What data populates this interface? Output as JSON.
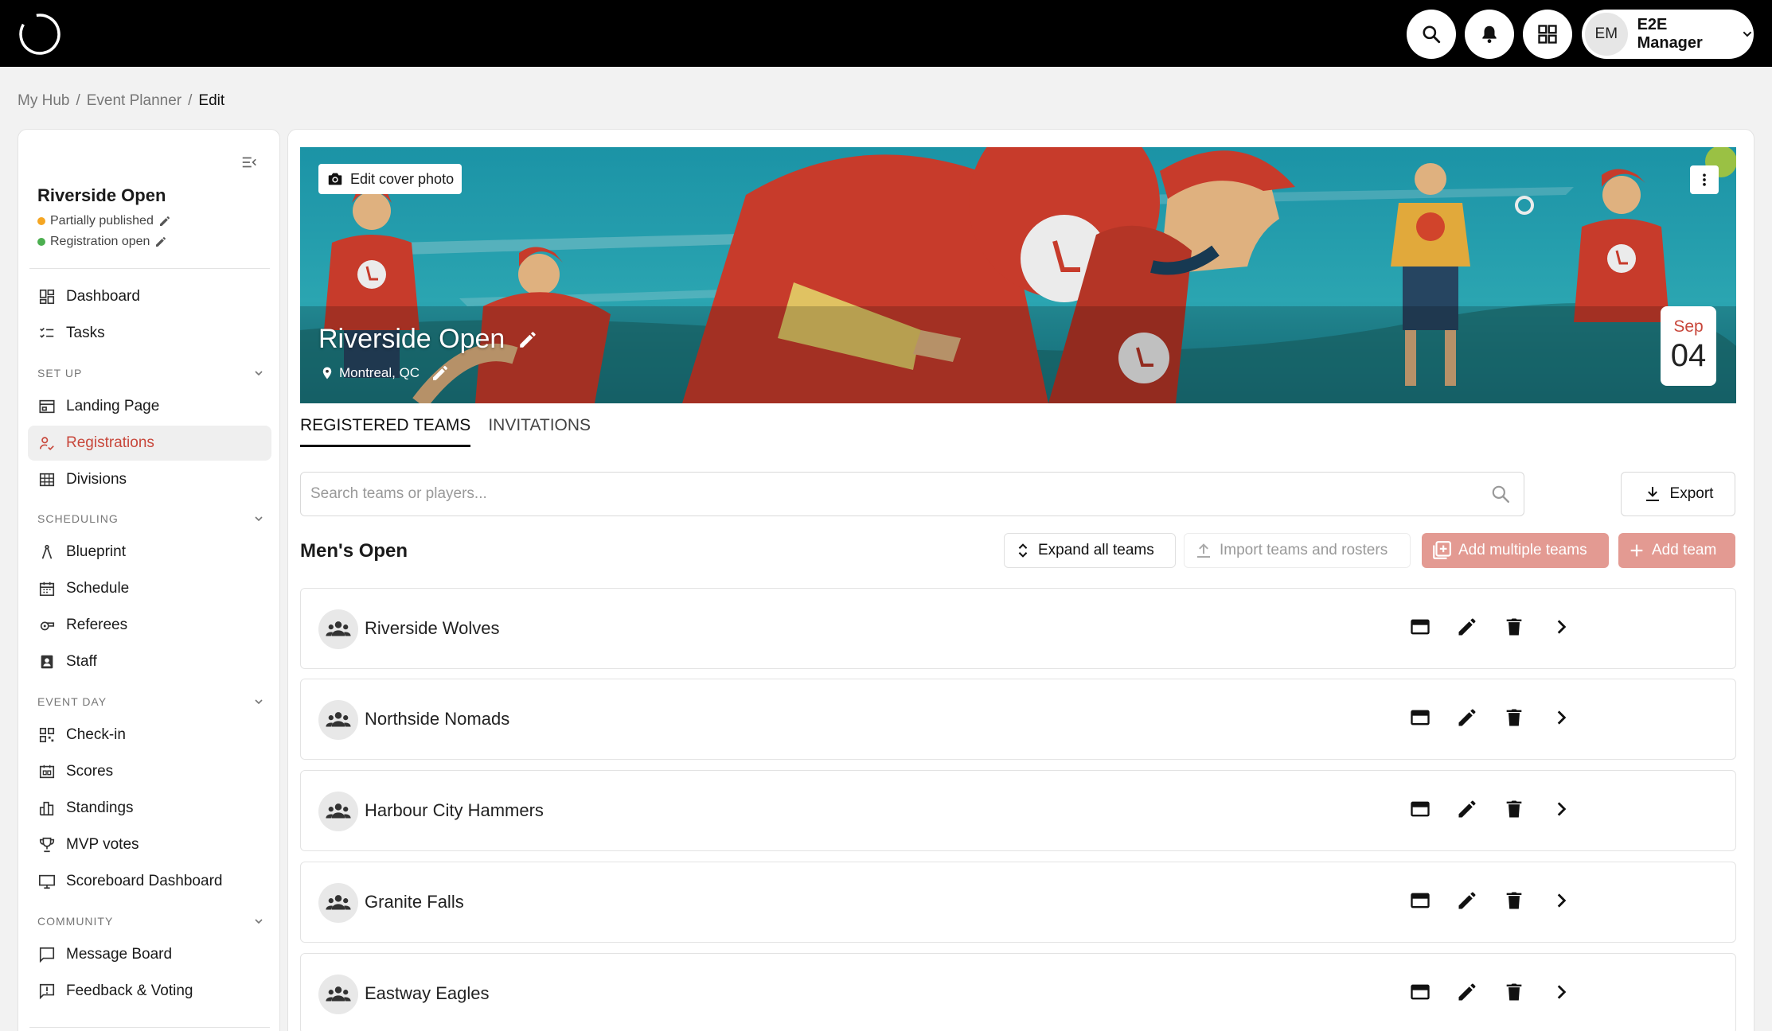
{
  "topbar": {
    "icons": [
      "search-icon",
      "bell-icon",
      "apps-grid-icon"
    ],
    "user": {
      "initials": "EM",
      "name": "E2E Manager"
    }
  },
  "breadcrumb": [
    "My Hub",
    "Event Planner",
    "Edit"
  ],
  "breadcrumb_sep": "/",
  "sidebar": {
    "event_name": "Riverside Open",
    "statuses": [
      {
        "label": "Partially published",
        "color": "#f5a623"
      },
      {
        "label": "Registration open",
        "color": "#4caf50"
      }
    ],
    "top_items": [
      {
        "label": "Dashboard",
        "icon": "dashboard-icon"
      },
      {
        "label": "Tasks",
        "icon": "tasks-icon"
      }
    ],
    "sections": [
      {
        "label": "SET UP",
        "items": [
          {
            "label": "Landing Page",
            "icon": "landing-page-icon"
          },
          {
            "label": "Registrations",
            "icon": "registrations-icon",
            "active": true
          },
          {
            "label": "Divisions",
            "icon": "divisions-icon"
          }
        ]
      },
      {
        "label": "SCHEDULING",
        "items": [
          {
            "label": "Blueprint",
            "icon": "blueprint-icon"
          },
          {
            "label": "Schedule",
            "icon": "schedule-icon"
          },
          {
            "label": "Referees",
            "icon": "referees-icon"
          },
          {
            "label": "Staff",
            "icon": "staff-icon"
          }
        ]
      },
      {
        "label": "EVENT DAY",
        "items": [
          {
            "label": "Check-in",
            "icon": "check-in-icon"
          },
          {
            "label": "Scores",
            "icon": "scores-icon"
          },
          {
            "label": "Standings",
            "icon": "standings-icon"
          },
          {
            "label": "MVP votes",
            "icon": "trophy-icon"
          },
          {
            "label": "Scoreboard Dashboard",
            "icon": "monitor-icon"
          }
        ]
      },
      {
        "label": "COMMUNITY",
        "items": [
          {
            "label": "Message Board",
            "icon": "message-board-icon"
          },
          {
            "label": "Feedback & Voting",
            "icon": "feedback-icon"
          }
        ]
      }
    ]
  },
  "cover": {
    "edit_label": "Edit cover photo",
    "title": "Riverside Open",
    "location": "Montreal, QC",
    "date_month": "Sep",
    "date_day": "04"
  },
  "tabs": [
    {
      "label": "REGISTERED TEAMS",
      "active": true
    },
    {
      "label": "INVITATIONS",
      "active": false
    }
  ],
  "search": {
    "placeholder": "Search teams or players...",
    "value": ""
  },
  "export_label": "Export",
  "division": {
    "title": "Men's Open",
    "expand_label": "Expand all teams",
    "import_label": "Import teams and rosters",
    "add_multiple_label": "Add multiple teams",
    "add_team_label": "Add team"
  },
  "teams": [
    {
      "name": "Riverside Wolves"
    },
    {
      "name": "Northside Nomads"
    },
    {
      "name": "Harbour City Hammers"
    },
    {
      "name": "Granite Falls"
    },
    {
      "name": "Eastway Eagles"
    }
  ],
  "colors": {
    "accent": "#c8473b",
    "accent_light": "#e39a92",
    "topbar": "#000000"
  }
}
